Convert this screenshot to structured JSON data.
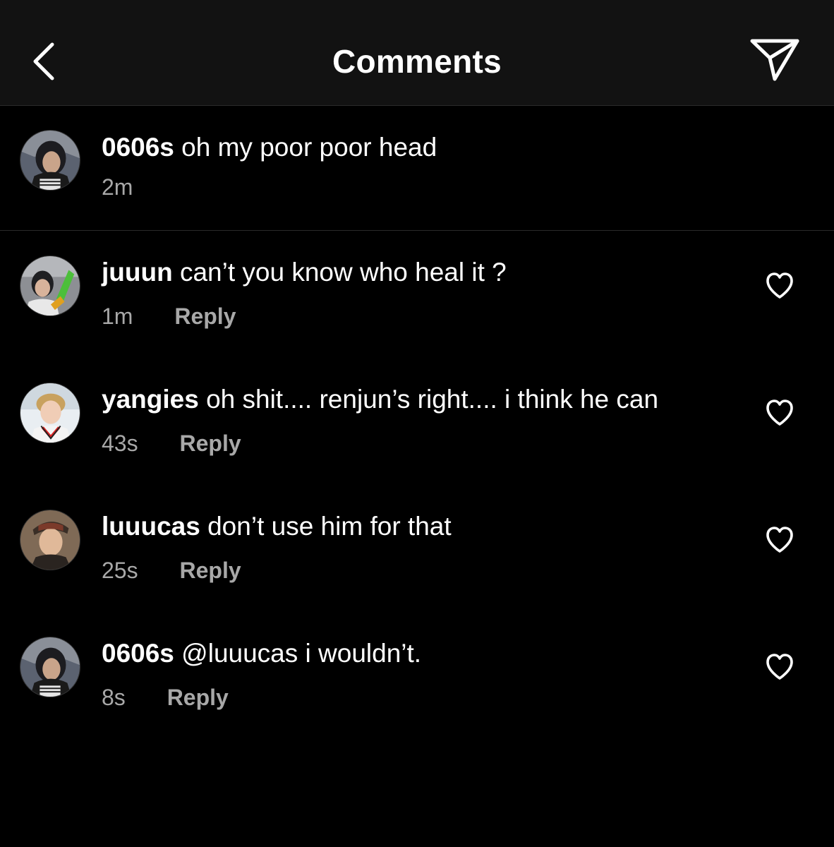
{
  "header": {
    "title": "Comments",
    "back_icon": "chevron-left-icon",
    "share_icon": "paper-plane-icon"
  },
  "caption": {
    "username": "0606s",
    "text": "oh my poor poor head",
    "time": "2m"
  },
  "comments": [
    {
      "username": "juuun",
      "text": "can’t you know who heal it ?",
      "time": "1m",
      "reply_label": "Reply",
      "like_icon": "heart-outline-icon"
    },
    {
      "username": "yangies",
      "text": "oh shit.... renjun’s right.... i think he can",
      "time": "43s",
      "reply_label": "Reply",
      "like_icon": "heart-outline-icon"
    },
    {
      "username": "luuucas",
      "text": "don’t use him for that",
      "time": "25s",
      "reply_label": "Reply",
      "like_icon": "heart-outline-icon"
    },
    {
      "username": "0606s",
      "text": "@luuucas i wouldn’t.",
      "time": "8s",
      "reply_label": "Reply",
      "like_icon": "heart-outline-icon"
    }
  ],
  "colors": {
    "background": "#000000",
    "header_background": "#121212",
    "primary_text": "#ffffff",
    "secondary_text": "#a8a8a8",
    "divider": "#2a2a2a"
  }
}
